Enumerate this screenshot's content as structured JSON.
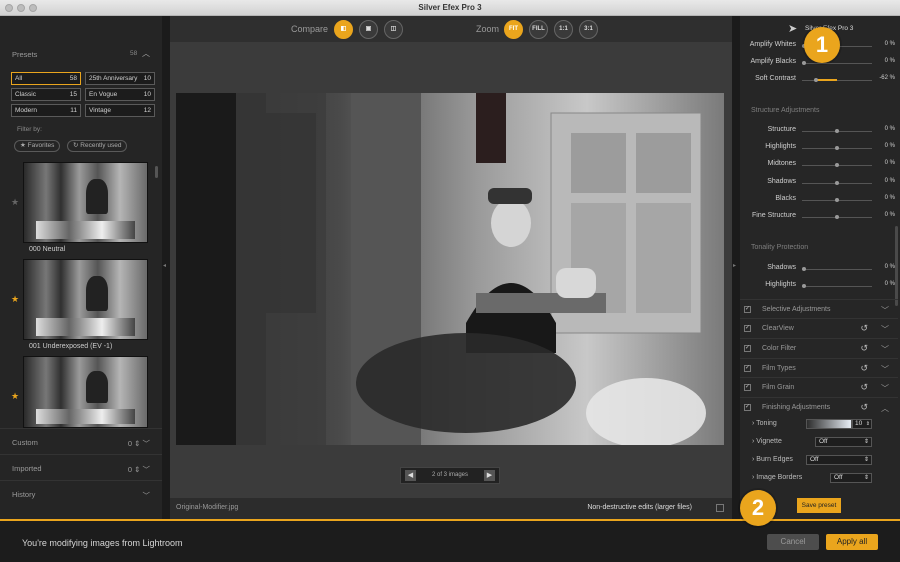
{
  "window": {
    "title": "Silver Efex Pro 3"
  },
  "top_bar": {
    "compare_label": "Compare",
    "zoom_label": "Zoom",
    "zoom_options": [
      "FIT",
      "FILL",
      "1:1",
      "3:1"
    ],
    "zoom_selected": "FIT"
  },
  "presets": {
    "title": "Presets",
    "count": "58",
    "categories": [
      {
        "label": "All",
        "count": "58"
      },
      {
        "label": "25th Anniversary",
        "count": "10"
      },
      {
        "label": "Classic",
        "count": "15"
      },
      {
        "label": "En Vogue",
        "count": "10"
      },
      {
        "label": "Modern",
        "count": "11"
      },
      {
        "label": "Vintage",
        "count": "12"
      }
    ],
    "filter_by_label": "Filter by:",
    "filters": [
      "Favorites",
      "Recently used"
    ],
    "items": [
      {
        "name": "000 Neutral",
        "favorite": false
      },
      {
        "name": "001 Underexposed (EV -1)",
        "favorite": true
      },
      {
        "name": "",
        "favorite": true
      }
    ]
  },
  "left_sections": [
    {
      "label": "Custom",
      "count": "0"
    },
    {
      "label": "Imported",
      "count": "0"
    },
    {
      "label": "History",
      "count": ""
    }
  ],
  "viewer": {
    "pagination": "2 of 3 images",
    "filename": "Original-Modifier.jpg",
    "nondestructive_label": "Non-destructive edits (larger files)"
  },
  "right_panel": {
    "brand": "Silver Efex Pro 3",
    "global_sliders": [
      {
        "label": "Amplify Whites",
        "value": "0 %",
        "level": 0
      },
      {
        "label": "Amplify Blacks",
        "value": "0 %",
        "level": 0
      },
      {
        "label": "Soft Contrast",
        "value": "-62 %",
        "level": -62
      }
    ],
    "structure_header": "Structure Adjustments",
    "structure_sliders": [
      {
        "label": "Structure",
        "value": "0 %"
      },
      {
        "label": "Highlights",
        "value": "0 %"
      },
      {
        "label": "Midtones",
        "value": "0 %"
      },
      {
        "label": "Shadows",
        "value": "0 %"
      },
      {
        "label": "Blacks",
        "value": "0 %"
      },
      {
        "label": "Fine Structure",
        "value": "0 %"
      }
    ],
    "tonality_header": "Tonality Protection",
    "tonality_sliders": [
      {
        "label": "Shadows",
        "value": "0 %"
      },
      {
        "label": "Highlights",
        "value": "0 %"
      }
    ],
    "sections": [
      {
        "label": "Selective Adjustments",
        "reset": false,
        "expanded": false
      },
      {
        "label": "ClearView",
        "reset": true,
        "expanded": false
      },
      {
        "label": "Color Filter",
        "reset": true,
        "expanded": false
      },
      {
        "label": "Film Types",
        "reset": true,
        "expanded": false
      },
      {
        "label": "Film Grain",
        "reset": true,
        "expanded": false
      },
      {
        "label": "Finishing Adjustments",
        "reset": true,
        "expanded": true
      }
    ],
    "finishing": {
      "toning_label": "Toning",
      "toning_value": "10",
      "vignette_label": "Vignette",
      "vignette_value": "Off",
      "burn_edges_label": "Burn Edges",
      "burn_edges_value": "Off",
      "image_borders_label": "Image Borders",
      "image_borders_value": "Off"
    },
    "save_preset_label": "Save preset"
  },
  "footer": {
    "message": "You're modifying images from Lightroom",
    "cancel_label": "Cancel",
    "apply_label": "Apply all"
  },
  "callouts": [
    "1",
    "2"
  ],
  "colors": {
    "accent": "#eaa51d"
  }
}
